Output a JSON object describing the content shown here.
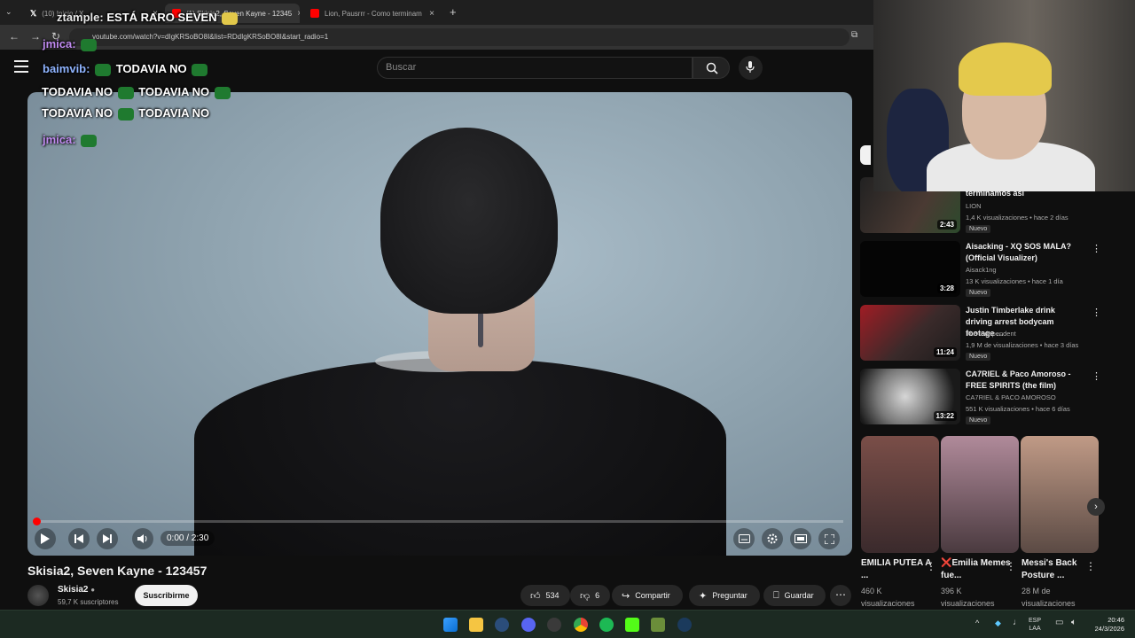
{
  "browser": {
    "tabs": [
      {
        "title": "(10) Inicio / X",
        "favicon_color": "#000000"
      },
      {
        "title": "(1) Skisia2, Seven Kayne - 12345",
        "favicon_color": "#ff0000"
      },
      {
        "title": "Lion, Pausrrr - Como terminam",
        "favicon_color": "#ff0000"
      }
    ],
    "new_tab": "+",
    "url": "youtube.com/watch?v=dIgKRSoBO8I&list=RDdIgKRSoBO8I&start_radio=1"
  },
  "youtube": {
    "search_placeholder": "Buscar",
    "player": {
      "time": "0:00 / 2:30",
      "progress_fraction": 0.0
    },
    "video_title": "Skisia2, Seven Kayne - 123457",
    "channel": {
      "name": "Skisia2",
      "subscribers": "59,7 K suscriptores",
      "subscribe_label": "Suscribirme"
    },
    "actions": {
      "likes": "534",
      "dislikes": "6",
      "share": "Compartir",
      "ask": "Preguntar",
      "save": "Guardar"
    }
  },
  "chat": [
    {
      "user": "ztample:",
      "text": "ESTÁ RARO SEVEN"
    },
    {
      "user": "jmica:",
      "text": ""
    },
    {
      "user": "baimvib:",
      "text": "TODAVIA NO"
    },
    {
      "user": "",
      "text": "TODAVIA NO"
    },
    {
      "user": "",
      "text": "TODAVIA NO"
    },
    {
      "user": "",
      "text": "TODAVIA NO"
    },
    {
      "user": "",
      "text": "TODAVIA NO"
    },
    {
      "user": "jmica:",
      "text": ""
    }
  ],
  "sidebar": {
    "recommendations": [
      {
        "title": "terminamos así",
        "channel": "LION",
        "meta": "1,4 K visualizaciones • hace 2 días",
        "badge": "Nuevo",
        "duration": "2:43",
        "thumb": "#3a3a3a"
      },
      {
        "title": "Aisacking - XQ SOS MALA? (Official Visualizer)",
        "channel": "Aisack1ng",
        "meta": "13 K visualizaciones • hace 1 día",
        "badge": "Nuevo",
        "duration": "3:28",
        "thumb": "#050505"
      },
      {
        "title": "Justin Timberlake drink driving arrest bodycam footage ...",
        "channel": "The Independent",
        "meta": "1,9 M de visualizaciones • hace 3 días",
        "badge": "Nuevo",
        "duration": "11:24",
        "thumb": "#6b1d22"
      },
      {
        "title": "CA7RIEL & Paco Amoroso - FREE SPIRITS (the film)",
        "channel": "CA7RIEL & PACO AMOROSO",
        "meta": "551 K visualizaciones • hace 6 días",
        "badge": "Nuevo",
        "duration": "13:22",
        "thumb": "#9a9a9a"
      }
    ],
    "shorts": [
      {
        "title": "EMILIA PUTEA A ...",
        "views": "460 K visualizaciones",
        "thumb": "#5a3d3a"
      },
      {
        "title": "❌Emilia Memes fue...",
        "views": "396 K visualizaciones",
        "thumb": "#6d4d5c"
      },
      {
        "title": "Messi's Back Posture ...",
        "views": "28 M de visualizaciones",
        "thumb": "#7a5e54"
      }
    ]
  },
  "taskbar": {
    "lang": "ESP",
    "lang2": "LAA",
    "time": "20:46",
    "date": "24/3/2026"
  }
}
